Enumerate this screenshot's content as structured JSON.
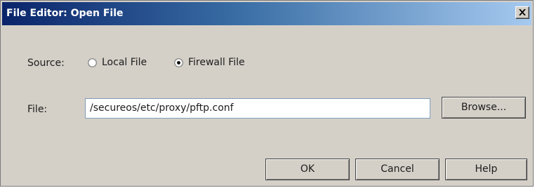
{
  "window": {
    "title": "File Editor: Open File",
    "close_label": "X"
  },
  "source": {
    "label": "Source:",
    "options": [
      {
        "label": "Local File",
        "selected": false
      },
      {
        "label": "Firewall File",
        "selected": true
      }
    ]
  },
  "file": {
    "label": "File:",
    "value": "/secureos/etc/proxy/pftp.conf",
    "browse_label": "Browse..."
  },
  "buttons": {
    "ok_label": "OK",
    "cancel_label": "Cancel",
    "help_label": "Help"
  },
  "colors": {
    "title_gradient_start": "#0a246a",
    "title_gradient_end": "#a6caf0",
    "dialog_background": "#d4d0c8"
  },
  "icons": {
    "close": "close-icon",
    "radio": "radio-button-icon"
  }
}
